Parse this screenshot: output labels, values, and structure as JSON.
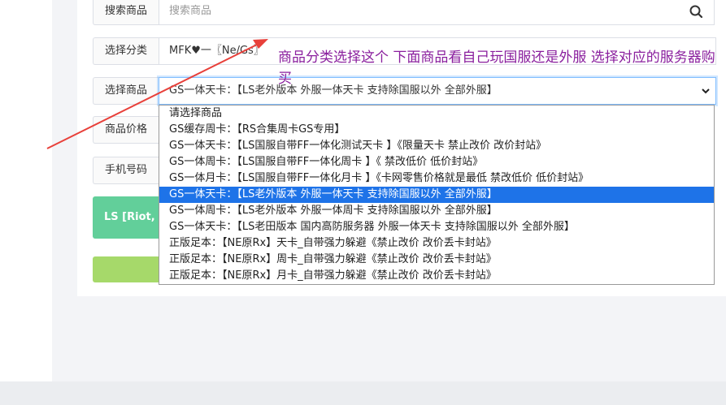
{
  "form": {
    "search_label": "搜索商品",
    "search_placeholder": "搜索商品",
    "category_label": "选择分类",
    "category_value": "MFK♥一〖Ne/Gs〗",
    "product_label": "选择商品",
    "product_value": "GS一体天卡：【LS老外版本 外服一体天卡 支持除国服以外 全部外服】",
    "price_label": "商品价格",
    "phone_label": "手机号码",
    "green_block_text": "LS [Riot, C"
  },
  "annotation": {
    "text": "商品分类选择这个 下面商品看自己玩国服还是外服 选择对应的服务器购买",
    "color": "#8a1f9e",
    "arrow_color": "#e8403a"
  },
  "dropdown": {
    "options": [
      "请选择商品",
      "GS缓存周卡：【RS合集周卡GS专用】",
      "GS一体天卡：【LS国服自带FF一体化测试天卡 】《限量天卡 禁止改价 改价封站》",
      "GS一体周卡：【LS国服自带FF一体化周卡 】《 禁改低价 低价封站》",
      "GS一体月卡：【LS国服自带FF一体化月卡 】《卡网零售价格就是最低 禁改低价 低价封站》",
      "GS一体天卡：【LS老外版本 外服一体天卡 支持除国服以外 全部外服】",
      "GS一体周卡：【LS老外版本 外服一体周卡 支持除国服以外 全部外服】",
      "GS一体天卡：【LS老田版本 国内高防服务器 外服一体天卡 支持除国服以外 全部外服】",
      "正版足本：【NE原Rx】天卡_自带强力躲避《禁止改价 改价丢卡封站》",
      "正版足本：【NE原Rx】周卡_自带强力躲避《禁止改价 改价丢卡封站》",
      "正版足本：【NE原Rx】月卡_自带强力躲避《禁止改价 改价丢卡封站》"
    ],
    "selected_index": 5,
    "selected_color": "#1e73e8"
  },
  "icons": {
    "search": "search-icon",
    "chevron": "chevron-down-icon"
  }
}
